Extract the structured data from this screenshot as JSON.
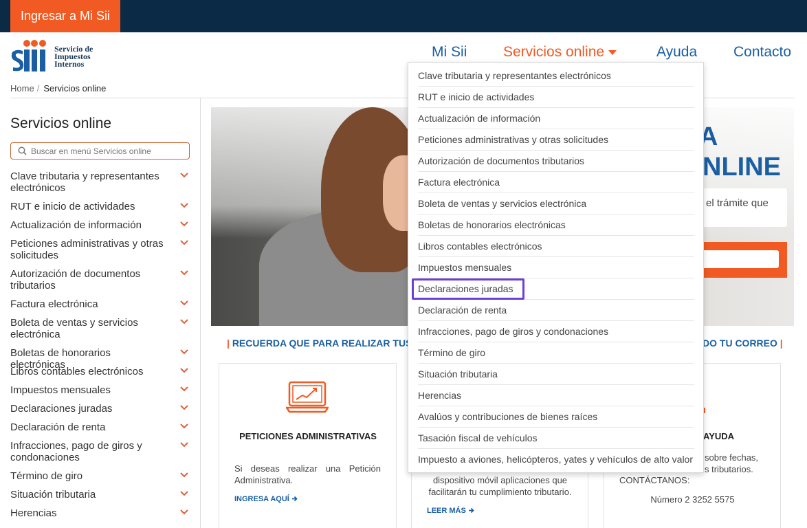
{
  "topbar": {
    "login_label": "Ingresar a Mi Sii"
  },
  "logo": {
    "mark": "Sii",
    "line1": "Servicio de",
    "line2": "Impuestos",
    "line3": "Internos"
  },
  "nav": {
    "mi_sii": "Mi Sii",
    "servicios": "Servicios online",
    "ayuda": "Ayuda",
    "contacto": "Contacto"
  },
  "breadcrumb": {
    "home": "Home",
    "separator": "/",
    "current": "Servicios online"
  },
  "sidebar": {
    "title": "Servicios online",
    "search_placeholder": "Buscar en menú Servicios online",
    "items": [
      {
        "label": "Clave tributaria y representantes electrónicos"
      },
      {
        "label": "RUT e inicio de actividades"
      },
      {
        "label": "Actualización de información"
      },
      {
        "label": "Peticiones administrativas y otras solicitudes"
      },
      {
        "label": "Autorización de documentos tributarios"
      },
      {
        "label": "Factura electrónica"
      },
      {
        "label": "Boleta de ventas y servicios electrónica"
      },
      {
        "label": "Boletas de honorarios electrónicas"
      },
      {
        "label": "Libros contables electrónicos"
      },
      {
        "label": "Impuestos mensuales"
      },
      {
        "label": "Declaraciones juradas"
      },
      {
        "label": "Declaración de renta"
      },
      {
        "label": "Infracciones, pago de giros y condonaciones"
      },
      {
        "label": "Término de giro"
      },
      {
        "label": "Situación tributaria"
      },
      {
        "label": "Herencias"
      }
    ]
  },
  "hero": {
    "headline1": "A",
    "headline2": "NLINE",
    "tag_text": "el  trámite  que"
  },
  "banner": {
    "left": "RECUERDA QUE PARA REALIZAR TUS T",
    "right": "DO TU CORREO",
    "bar": "|"
  },
  "cards": {
    "peticiones": {
      "title": "PETICIONES ADMINISTRATIVAS",
      "text": "Si deseas realizar una Petición Administrativa.",
      "link": "INGRESA AQUÍ"
    },
    "apps": {
      "text": "dispositivo móvil aplicaciones que facilitarán tu cumplimiento tributario.",
      "link": "LEER MÁS"
    },
    "ayuda": {
      "title": "AYUDA",
      "text": "sobre fechas, s tributarios.",
      "contact_label": "CONTÁCTANOS:",
      "phone": "Número 2 3252 5575"
    }
  },
  "dropdown": {
    "items": [
      "Clave tributaria y representantes electrónicos",
      "RUT e inicio de actividades",
      "Actualización de información",
      "Peticiones administrativas y otras solicitudes",
      "Autorización de documentos tributarios",
      "Factura electrónica",
      "Boleta de ventas y servicios electrónica",
      "Boletas de honorarios electrónicas",
      "Libros contables electrónicos",
      "Impuestos mensuales",
      "Declaraciones juradas",
      "Declaración de renta",
      "Infracciones, pago de giros y condonaciones",
      "Término de giro",
      "Situación tributaria",
      "Herencias",
      "Avalúos y contribuciones de bienes raíces",
      "Tasación fiscal de vehículos",
      "Impuesto a aviones, helicópteros, yates y vehículos de alto valor"
    ],
    "highlighted": "Declaraciones juradas"
  },
  "colors": {
    "navy": "#0b2a45",
    "orange": "#f15a22",
    "blue": "#1a5fa3",
    "highlight": "#6b3fd8"
  },
  "icons": {
    "search": "search-icon",
    "chevron": "chevron-down-icon",
    "caret": "caret-down-icon",
    "arrow": "arrow-right-icon",
    "laptop": "laptop-chart-icon"
  }
}
